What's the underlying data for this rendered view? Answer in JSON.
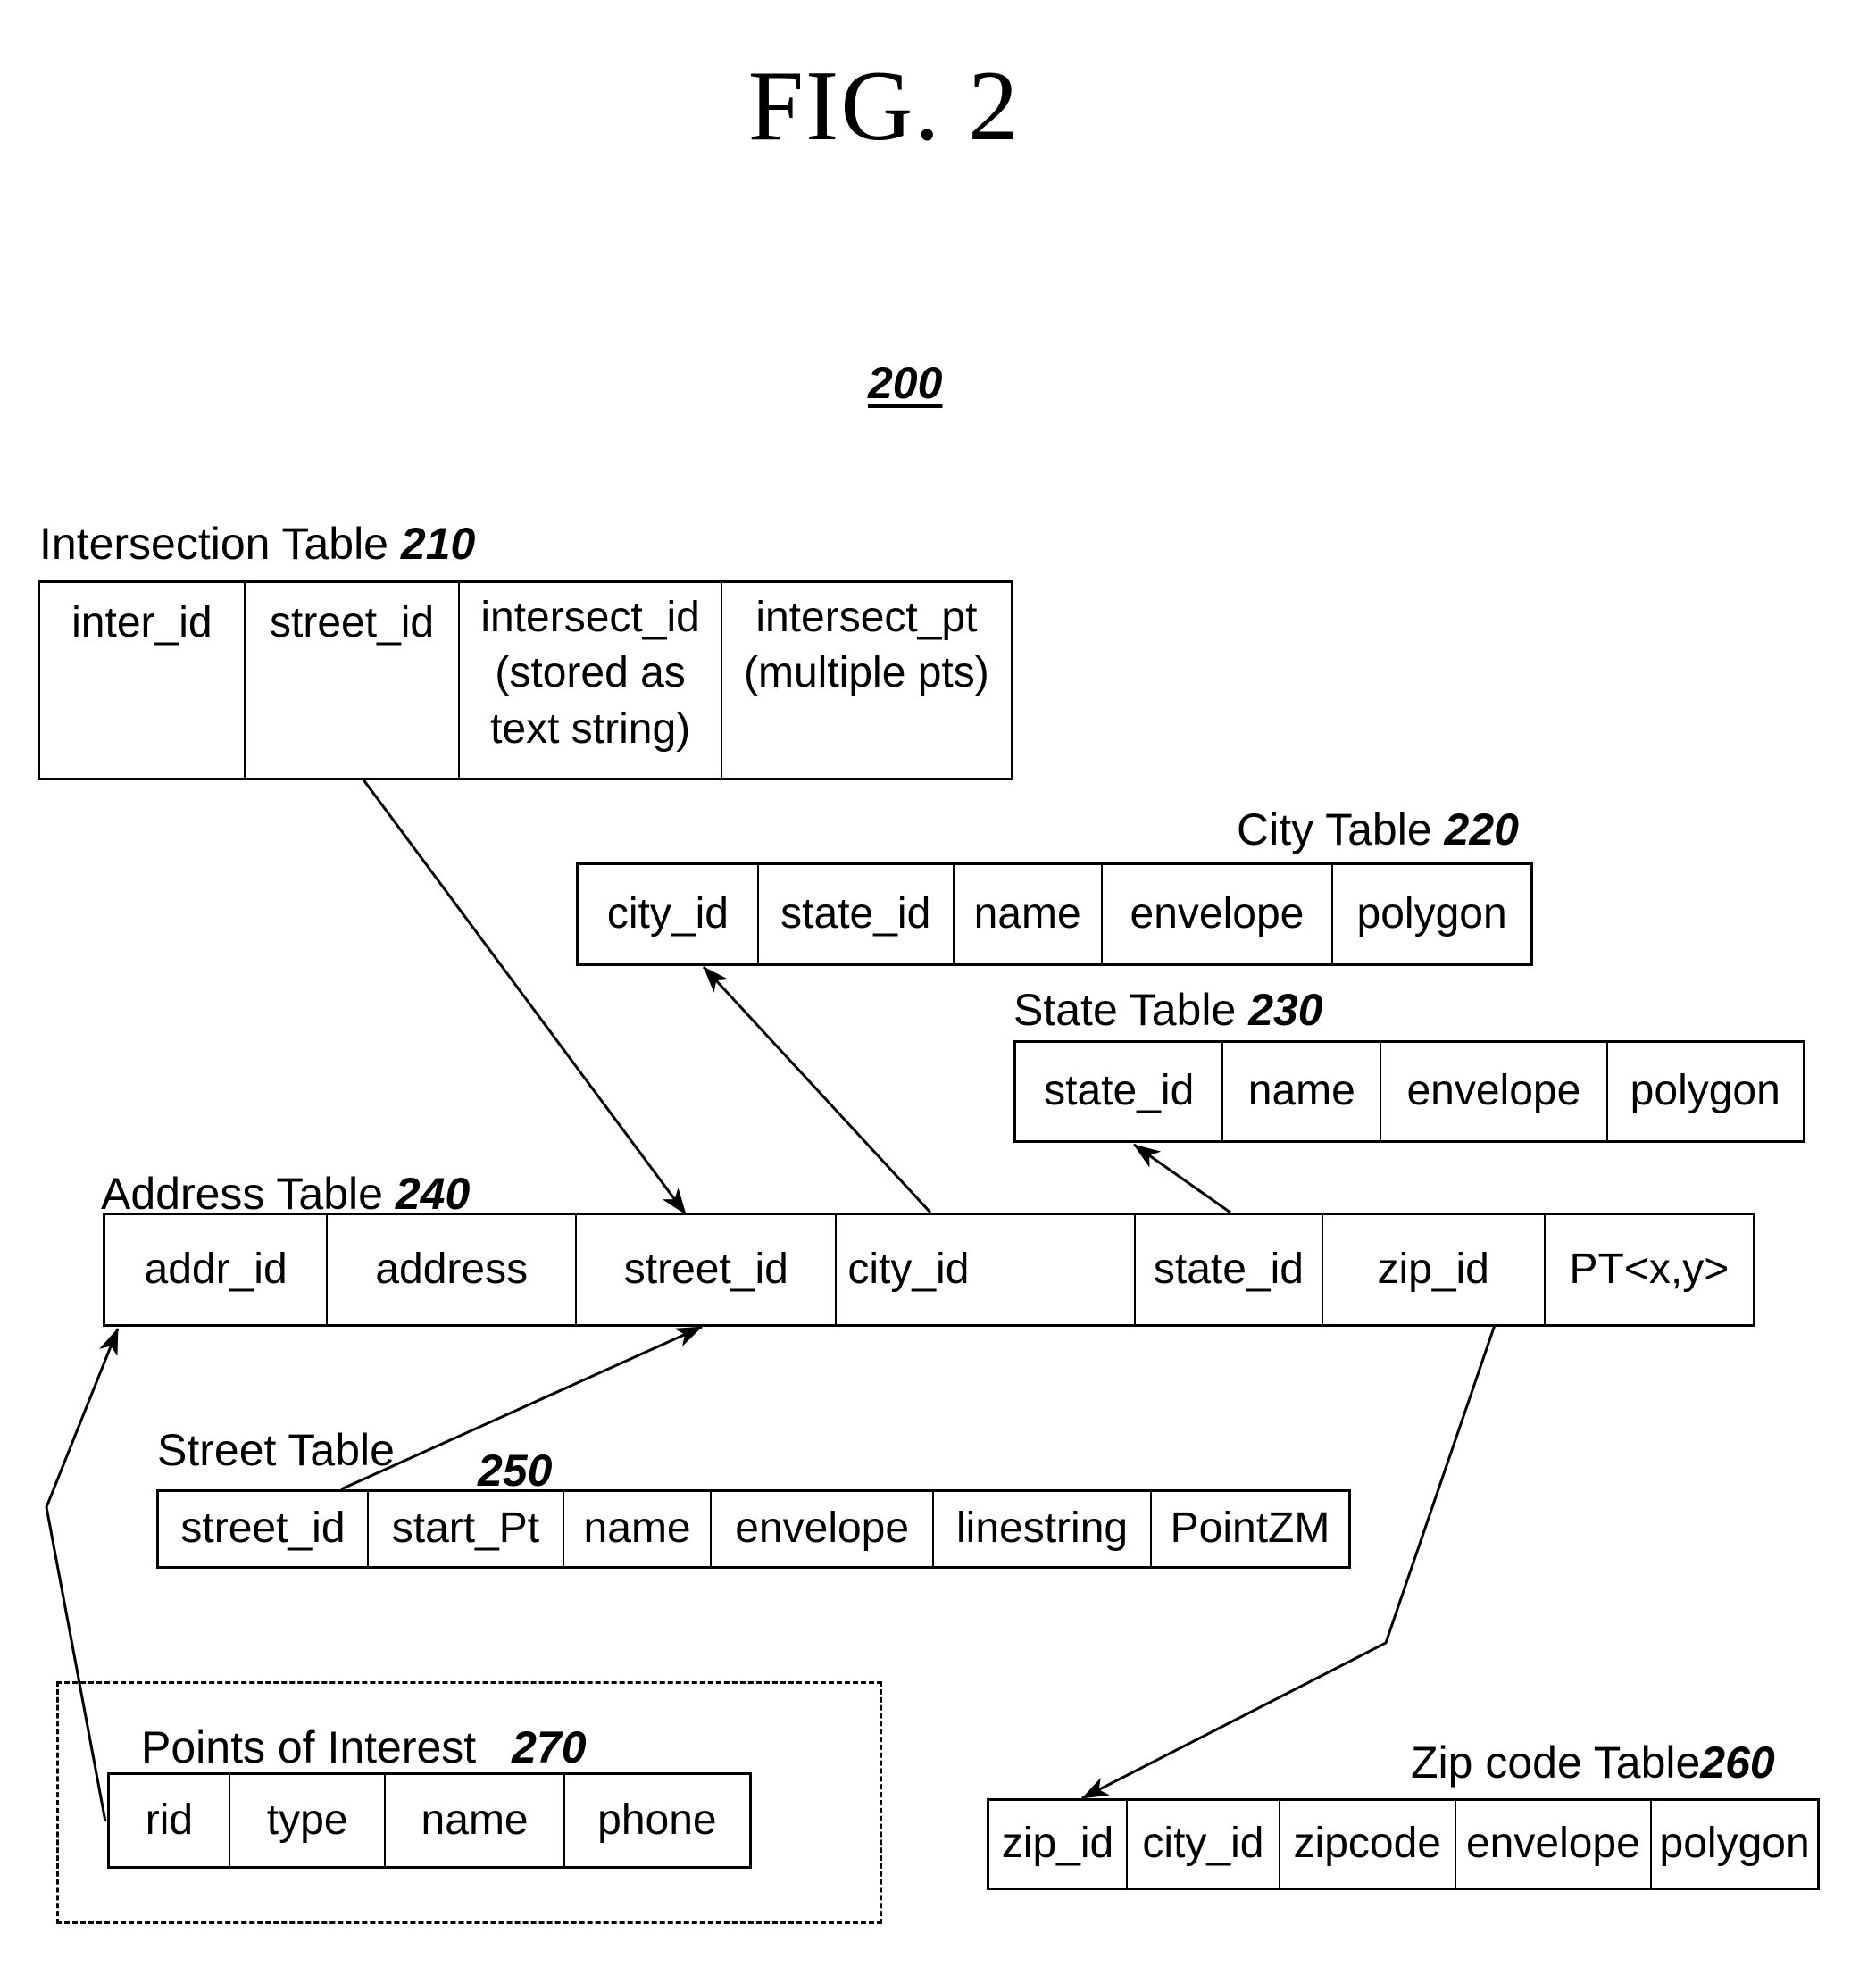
{
  "figure": {
    "title": "FIG. 2",
    "ref": "200"
  },
  "tables": {
    "intersection": {
      "label": "Intersection Table",
      "ref": "210",
      "columns": [
        "inter_id",
        "street_id",
        "intersect_id\n(stored as\ntext string)",
        "intersect_pt\n(multiple pts)"
      ]
    },
    "city": {
      "label": "City Table",
      "ref": "220",
      "columns": [
        "city_id",
        "state_id",
        "name",
        "envelope",
        "polygon"
      ]
    },
    "state": {
      "label": "State Table",
      "ref": "230",
      "columns": [
        "state_id",
        "name",
        "envelope",
        "polygon"
      ]
    },
    "address": {
      "label": "Address Table",
      "ref": "240",
      "columns": [
        "addr_id",
        "address",
        "street_id",
        "city_id",
        "state_id",
        "zip_id",
        "PT<x,y>"
      ]
    },
    "street": {
      "label": "Street Table",
      "ref": "250",
      "columns": [
        "street_id",
        "start_Pt",
        "name",
        "envelope",
        "linestring",
        "PointZM"
      ]
    },
    "zipcode": {
      "label": "Zip code Table",
      "ref": "260",
      "columns": [
        "zip_id",
        "city_id",
        "zipcode",
        "envelope",
        "polygon"
      ]
    },
    "poi": {
      "label": "Points of Interest",
      "ref": "270",
      "columns": [
        "rid",
        "type",
        "name",
        "phone"
      ]
    }
  },
  "relationships": [
    {
      "from": "intersection.street_id",
      "to": "address.street_id"
    },
    {
      "from": "address.city_id",
      "to": "city.city_id"
    },
    {
      "from": "address.state_id",
      "to": "state.state_id"
    },
    {
      "from": "street.street_id",
      "to": "address.street_id"
    },
    {
      "from": "address.zip_id",
      "to": "zipcode.zip_id"
    },
    {
      "from": "poi.rid",
      "to": "address.addr_id"
    }
  ]
}
